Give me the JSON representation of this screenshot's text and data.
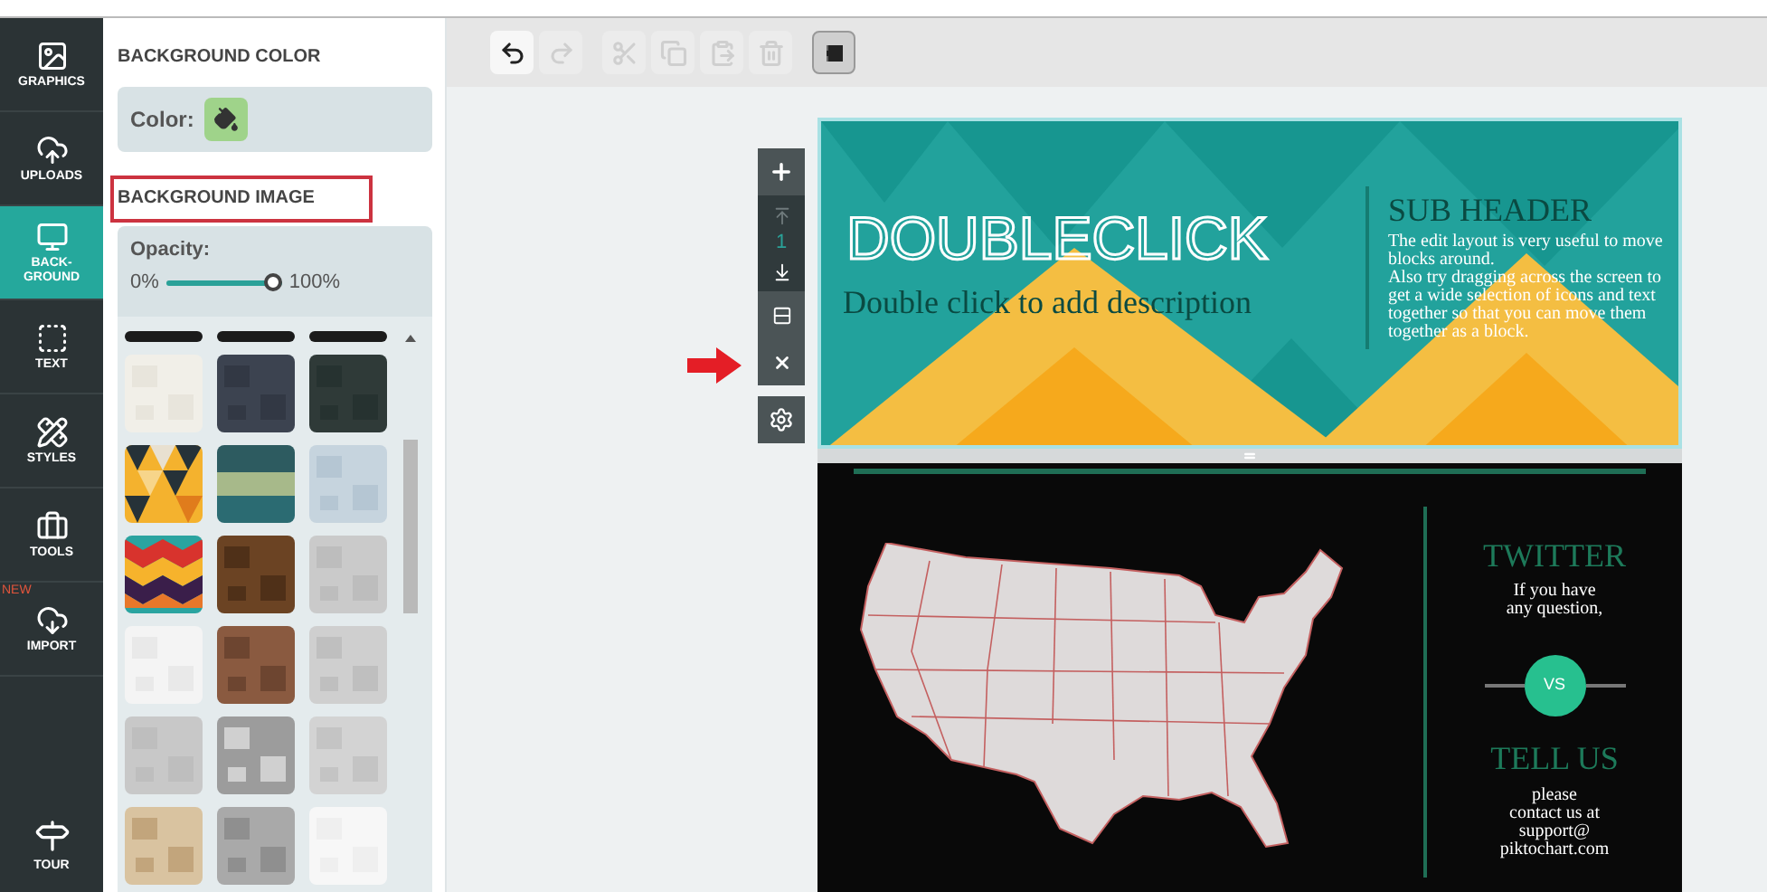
{
  "nav": [
    {
      "label": "GRAPHICS",
      "selected": false
    },
    {
      "label": "UPLOADS",
      "selected": false
    },
    {
      "label": "BACK-\nGROUND",
      "selected": true
    },
    {
      "label": "TEXT",
      "selected": false
    },
    {
      "label": "STYLES",
      "selected": false
    },
    {
      "label": "TOOLS",
      "selected": false
    },
    {
      "label": "IMPORT",
      "selected": false,
      "badge": "NEW"
    }
  ],
  "tour": {
    "label": "TOUR"
  },
  "panel": {
    "color_heading": "BACKGROUND COLOR",
    "color_label": "Color:",
    "image_heading": "BACKGROUND IMAGE",
    "opacity_label": "Opacity:",
    "opacity_min": "0%",
    "opacity_max": "100%",
    "opacity": {
      "level": 1
    }
  },
  "toolbar": [
    {
      "kind": "button",
      "disabled": false
    },
    {
      "kind": "button",
      "disabled": true
    },
    {
      "kind": "button",
      "disabled": true
    },
    {
      "kind": "button",
      "disabled": true
    },
    {
      "kind": "button",
      "disabled": true
    },
    {
      "kind": "button",
      "disabled": true
    },
    {
      "kind": "toggle",
      "selected": true
    }
  ],
  "block_tools": {
    "block_number": "1"
  },
  "header_block": {
    "title": "DOUBLECLICK",
    "description": "Double click to add description",
    "subheader": "SUB HEADER",
    "body": "The edit layout is very useful to move blocks around.\nAlso try dragging across the screen to get a wide selection of icons and text together so that you can move them together as a block."
  },
  "contact_block": {
    "title_1": "TWITTER",
    "text_1": "If you have\nany question,",
    "badge": "VS",
    "title_2": "TELL US",
    "text_2": "please\ncontact us at\nsupport@\npiktochart.com"
  }
}
